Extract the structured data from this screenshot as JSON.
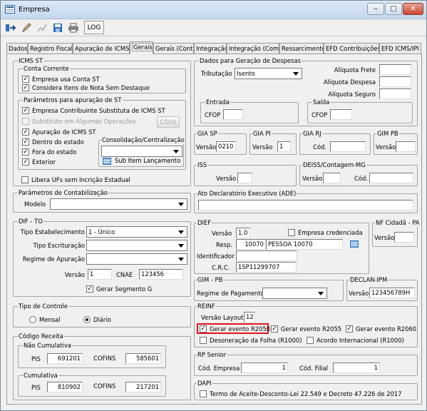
{
  "window": {
    "title": "Empresa",
    "controls": {
      "minimize": "‒",
      "maximize": "□",
      "close": "✕"
    }
  },
  "toolbar": {
    "log_label": "LOG",
    "icons": [
      "enter-icon",
      "edit-icon",
      "chart-icon",
      "save-icon",
      "print-icon"
    ]
  },
  "tabs": [
    {
      "label": "Dados"
    },
    {
      "label": "Registro Fiscal"
    },
    {
      "label": "Apuração de ICMS"
    },
    {
      "label": "Gerais",
      "active": true
    },
    {
      "label": "Gerais (Cont.)"
    },
    {
      "label": "Integração"
    },
    {
      "label": "Integração (Com.)"
    },
    {
      "label": "Ressarcimento"
    },
    {
      "label": "EFD Contribuições"
    },
    {
      "label": "EFD ICMS/IPI"
    }
  ],
  "icms_st": {
    "title": "ICMS ST",
    "conta_corrente": {
      "title": "Conta Corrente",
      "usa_conta": {
        "label": "Empresa usa Conta ST",
        "checked": true
      },
      "considera_itens": {
        "label": "Considera Itens de Nota Sem Destaque",
        "checked": true
      }
    },
    "parametros": {
      "title": "Parâmetros para apuração de ST",
      "substituta": {
        "label": "Empresa Contribuinte Substituta de ICMS ST",
        "checked": true
      },
      "substituto_algumas": {
        "label": "Substituto em Algumas Operações",
        "checked": false
      },
      "cgos_button": "CGOs",
      "apuracao": {
        "label": "Apuração de ICMS ST",
        "checked": true
      },
      "dentro_estado": {
        "label": "Dentro do estado",
        "checked": true
      },
      "fora_estado": {
        "label": "Fora do estado",
        "checked": true
      },
      "exterior": {
        "label": "Exterior",
        "checked": true
      },
      "consolidacao": {
        "title": "Consolidação/Centralização",
        "value": ""
      },
      "sub_item_button": "Sub Item Lançamento"
    },
    "libera_ufs": {
      "label": "Libera UFs sem Incrição Estadual",
      "checked": false
    }
  },
  "contabilizacao": {
    "title": "Parâmetros de Contabilização",
    "modelo_label": "Modelo",
    "modelo_value": ""
  },
  "dif_to": {
    "title": "DIF - TO",
    "tipo_estab_label": "Tipo Estabelecimento",
    "tipo_estab_value": "1 - Único",
    "tipo_escrit_label": "Tipo Escrituração",
    "tipo_escrit_value": "",
    "regime_label": "Regime de Apuração",
    "regime_value": "",
    "versao_label": "Versão",
    "versao_value": "1",
    "cnae_label": "CNAE",
    "cnae_value": "123456",
    "gerar_segmento": {
      "label": "Gerar Segmento G",
      "checked": true
    }
  },
  "tipo_controle": {
    "title": "Tipo de Controle",
    "mensal": {
      "label": "Mensal",
      "selected": false
    },
    "diario": {
      "label": "Diário",
      "selected": true
    }
  },
  "codigo_receita": {
    "title": "Código Receita",
    "nao_cumulativa": {
      "title": "Não Cumulativa",
      "pis_label": "PIS",
      "pis_value": "691201",
      "cofins_label": "COFINS",
      "cofins_value": "585601"
    },
    "cumulativa": {
      "title": "Cumulativa",
      "pis_label": "PIS",
      "pis_value": "810902",
      "cofins_label": "COFINS",
      "cofins_value": "217201"
    }
  },
  "despesas": {
    "title": "Dados para Geração de Despesas",
    "tributacao_label": "Tributação",
    "tributacao_value": "Isento",
    "aliquota_frete": "Alíquota Frete",
    "aliquota_despesa": "Alíquota Despesa",
    "aliquota_seguro": "Alíquota Seguro",
    "entrada": {
      "title": "Entrada",
      "cfop_label": "CFOP",
      "cfop_value": ""
    },
    "saida": {
      "title": "Saída",
      "cfop_label": "CFOP",
      "cfop_value": ""
    }
  },
  "gia_sp": {
    "title": "GIA SP",
    "versao_label": "Versão",
    "versao_value": "0210"
  },
  "gia_pi": {
    "title": "GIA PI",
    "versao_label": "Versão",
    "versao_value": "1"
  },
  "gia_rj": {
    "title": "GIA RJ",
    "cod_label": "Cód.",
    "cod_value": ""
  },
  "gim_pb_top": {
    "title": "GIM PB",
    "versao_label": "Versão",
    "versao_value": ""
  },
  "iss": {
    "title": "ISS",
    "versao_label": "Versão",
    "versao_value": ""
  },
  "deiss": {
    "title": "DEISS/Contagem-MG",
    "versao_label": "Versão",
    "versao_value": "",
    "cod_label": "Cód.",
    "cod_value": ""
  },
  "ade": {
    "title": "Ato Declaratório Executivo (ADE)",
    "value": ""
  },
  "dief": {
    "title": "DIEF",
    "versao_label": "Versão",
    "versao_value": "1.0",
    "empresa_credenciada": {
      "label": "Empresa credenciada",
      "checked": false
    },
    "resp_label": "Resp.",
    "resp_code": "10070",
    "resp_name": "PESSOA 10070",
    "identificador_label": "Identificador",
    "identificador_value": "",
    "crc_label": "C.R.C.",
    "crc_value": "1SP11299707"
  },
  "nf_cidada": {
    "title": "NF Cidadã - PA",
    "versao_label": "Versão",
    "versao_value": ""
  },
  "gim_pb": {
    "title": "GIM - PB",
    "regime_label": "Regime de Pagamento",
    "regime_value": ""
  },
  "declan": {
    "title": "DECLAN-IPM",
    "versao_label": "Versão",
    "versao_value": "123456789H"
  },
  "reinf": {
    "title": "REINF",
    "versao_layout_label": "Versão Layout",
    "versao_layout_value": "12",
    "r2050": {
      "label": "Gerar evento R2050",
      "checked": true
    },
    "r2055": {
      "label": "Gerar evento R2055",
      "checked": true
    },
    "r2060": {
      "label": "Gerar evento R2060",
      "checked": true
    },
    "desoneracao": {
      "label": "Desoneração da Folha (R1000)",
      "checked": false
    },
    "acordo": {
      "label": "Acordo Internacional (R1000)",
      "checked": false
    },
    "highlight_color": "#e0141e"
  },
  "rp_senior": {
    "title": "RP Senior",
    "cod_empresa_label": "Cód. Empresa",
    "cod_empresa_value": "1",
    "cod_filial_label": "Cód. Filial",
    "cod_filial_value": "1"
  },
  "dapi": {
    "title": "DAPI",
    "termo": {
      "label": "Termo de Aceite-Desconto-Lei 22.549 e Decreto 47.226 de 2017",
      "checked": false
    }
  }
}
